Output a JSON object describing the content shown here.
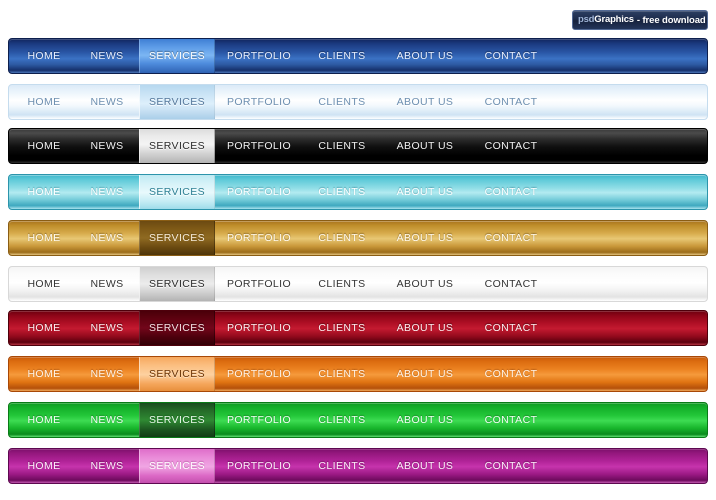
{
  "badge": {
    "psd_text": "psd",
    "graphics_text": "Graphics",
    "swoosh_icon": "swoosh-icon",
    "free_download_text": "- free download"
  },
  "menu_labels": {
    "home": "HOME",
    "news": "NEWS",
    "services": "SERVICES",
    "portfolio": "PORTFOLIO",
    "clients": "CLIENTS",
    "about_us": "ABOUT US",
    "contact": "CONTACT"
  },
  "active_item": "SERVICES",
  "navbars": [
    {
      "name": "blue",
      "theme_class": "t-blue",
      "accent": "#3b72c4",
      "items": [
        "HOME",
        "NEWS",
        "SERVICES",
        "PORTFOLIO",
        "CLIENTS",
        "ABOUT US",
        "CONTACT"
      ]
    },
    {
      "name": "light-blue",
      "theme_class": "t-lightblue",
      "accent": "#c9e3f5",
      "items": [
        "HOME",
        "NEWS",
        "SERVICES",
        "PORTFOLIO",
        "CLIENTS",
        "ABOUT US",
        "CONTACT"
      ]
    },
    {
      "name": "black",
      "theme_class": "t-black",
      "accent": "#000000",
      "items": [
        "HOME",
        "NEWS",
        "SERVICES",
        "PORTFOLIO",
        "CLIENTS",
        "ABOUT US",
        "CONTACT"
      ]
    },
    {
      "name": "cyan",
      "theme_class": "t-cyan",
      "accent": "#8fdde6",
      "items": [
        "HOME",
        "NEWS",
        "SERVICES",
        "PORTFOLIO",
        "CLIENTS",
        "ABOUT US",
        "CONTACT"
      ]
    },
    {
      "name": "gold",
      "theme_class": "t-gold",
      "accent": "#d7ab4c",
      "items": [
        "HOME",
        "NEWS",
        "SERVICES",
        "PORTFOLIO",
        "CLIENTS",
        "ABOUT US",
        "CONTACT"
      ]
    },
    {
      "name": "white",
      "theme_class": "t-white",
      "accent": "#ececec",
      "items": [
        "HOME",
        "NEWS",
        "SERVICES",
        "PORTFOLIO",
        "CLIENTS",
        "ABOUT US",
        "CONTACT"
      ]
    },
    {
      "name": "red",
      "theme_class": "t-red",
      "accent": "#b00f25",
      "items": [
        "HOME",
        "NEWS",
        "SERVICES",
        "PORTFOLIO",
        "CLIENTS",
        "ABOUT US",
        "CONTACT"
      ]
    },
    {
      "name": "orange",
      "theme_class": "t-orange",
      "accent": "#ec8221",
      "items": [
        "HOME",
        "NEWS",
        "SERVICES",
        "PORTFOLIO",
        "CLIENTS",
        "ABOUT US",
        "CONTACT"
      ]
    },
    {
      "name": "green",
      "theme_class": "t-green",
      "accent": "#22c638",
      "items": [
        "HOME",
        "NEWS",
        "SERVICES",
        "PORTFOLIO",
        "CLIENTS",
        "ABOUT US",
        "CONTACT"
      ]
    },
    {
      "name": "magenta",
      "theme_class": "t-magenta",
      "accent": "#b12398",
      "items": [
        "HOME",
        "NEWS",
        "SERVICES",
        "PORTFOLIO",
        "CLIENTS",
        "ABOUT US",
        "CONTACT"
      ]
    }
  ]
}
